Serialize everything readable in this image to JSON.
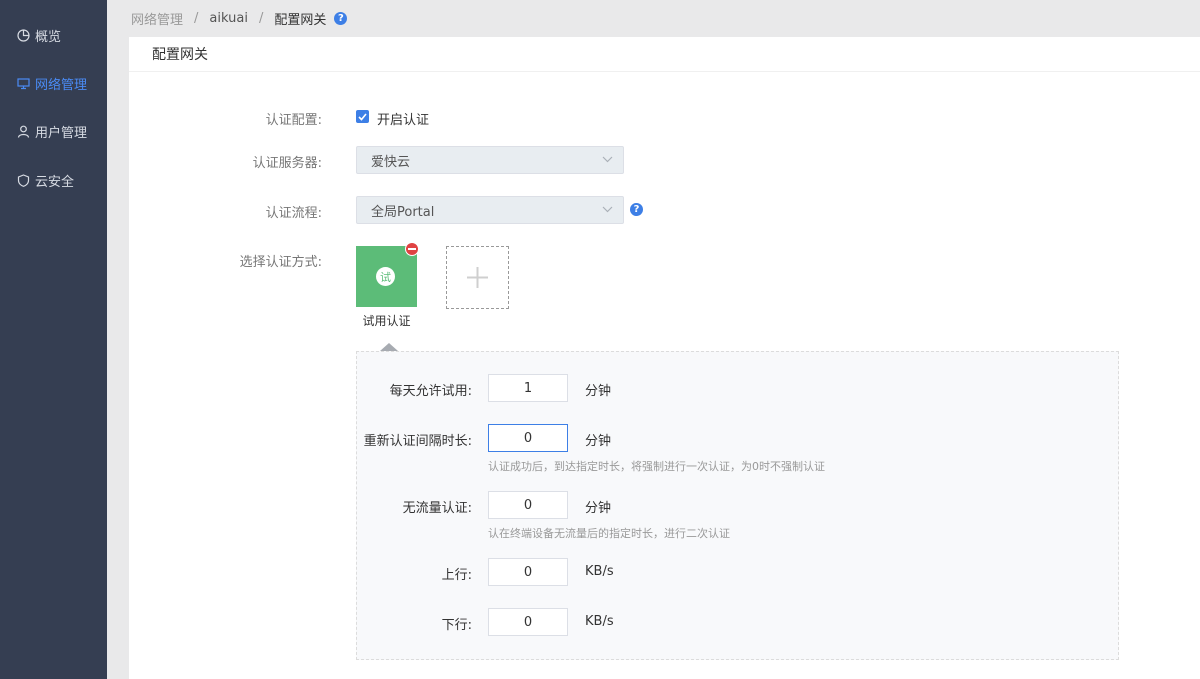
{
  "sidebar": {
    "items": [
      {
        "label": "概览",
        "icon": "pie-chart-icon",
        "active": false
      },
      {
        "label": "网络管理",
        "icon": "monitor-icon",
        "active": true
      },
      {
        "label": "用户管理",
        "icon": "user-icon",
        "active": false
      },
      {
        "label": "云安全",
        "icon": "shield-icon",
        "active": false
      }
    ]
  },
  "breadcrumb": {
    "root": "网络管理",
    "mid": "aikuai",
    "current": "配置网关",
    "sep": "/",
    "help": "?"
  },
  "panel": {
    "title": "配置网关"
  },
  "form": {
    "auth_config": {
      "label": "认证配置:",
      "checkbox_label": "开启认证",
      "checked": true
    },
    "auth_server": {
      "label": "认证服务器:",
      "value": "爱快云"
    },
    "auth_flow": {
      "label": "认证流程:",
      "value": "全局Portal",
      "help": "?"
    },
    "auth_method": {
      "label": "选择认证方式:",
      "methods": [
        {
          "label": "试用认证",
          "icon_text": "试"
        }
      ],
      "add": "+"
    }
  },
  "trial": {
    "daily_allowed": {
      "label": "每天允许试用:",
      "value": "1",
      "unit": "分钟"
    },
    "reauth_interval": {
      "label": "重新认证间隔时长:",
      "value": "0",
      "unit": "分钟",
      "hint": "认证成功后，到达指定时长，将强制进行一次认证，为0时不强制认证"
    },
    "no_traffic": {
      "label": "无流量认证:",
      "value": "0",
      "unit": "分钟",
      "hint": "认在终端设备无流量后的指定时长，进行二次认证"
    },
    "upload": {
      "label": "上行:",
      "value": "0",
      "unit": "KB/s"
    },
    "download": {
      "label": "下行:",
      "value": "0",
      "unit": "KB/s"
    }
  },
  "colors": {
    "sidebar_bg": "#353e52",
    "accent": "#3d7fe6",
    "tile_green": "#5cbc78",
    "remove_red": "#e04343"
  }
}
